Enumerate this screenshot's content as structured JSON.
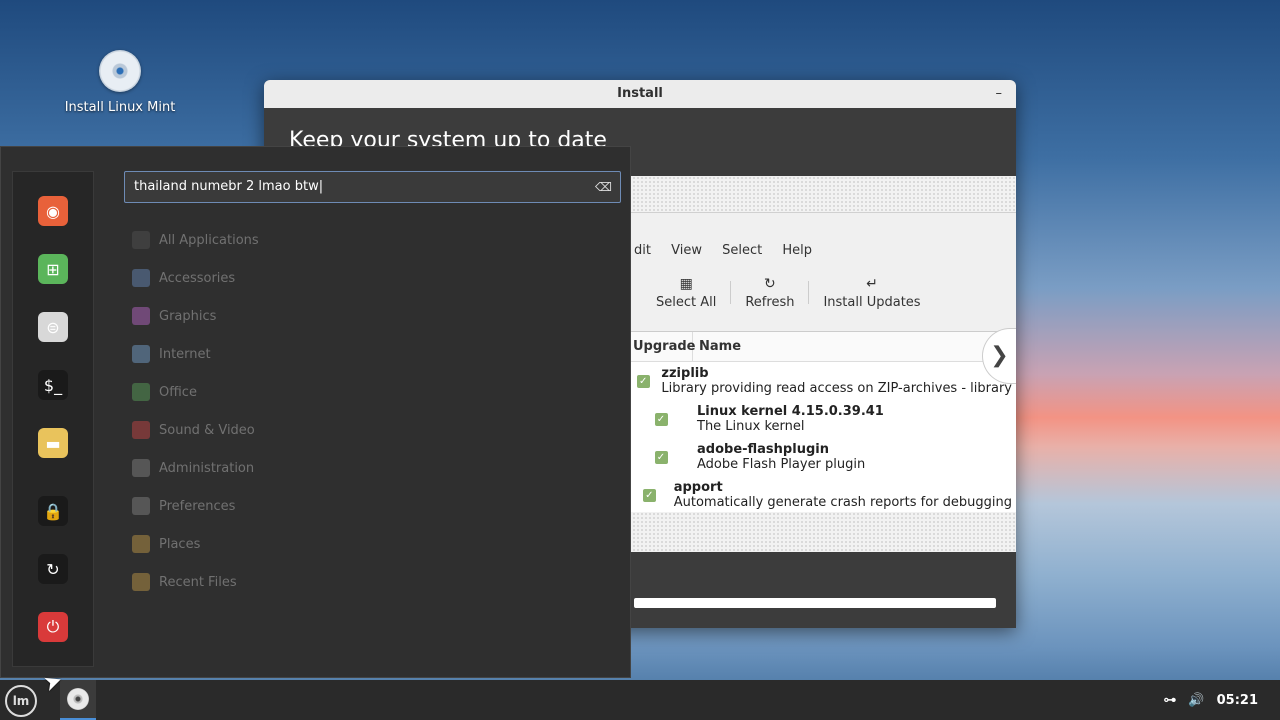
{
  "desktop": {
    "icon_label": "Install Linux Mint"
  },
  "window": {
    "title": "Install",
    "minimize": "–",
    "heading": "Keep your system up to date",
    "menu": [
      "dit",
      "View",
      "Select",
      "Help"
    ],
    "toolbar": [
      {
        "icon": "select-all-icon",
        "glyph": "▦",
        "label": "Select All"
      },
      {
        "icon": "refresh-icon",
        "glyph": "↻",
        "label": "Refresh"
      },
      {
        "icon": "install-icon",
        "glyph": "↵",
        "label": "Install Updates"
      }
    ],
    "columns": {
      "upgrade": "Upgrade",
      "name": "Name"
    },
    "rows": [
      {
        "name": "zziplib",
        "desc": "Library providing read access on ZIP-archives - library"
      },
      {
        "name": "Linux kernel 4.15.0.39.41",
        "desc": "The Linux kernel"
      },
      {
        "name": "adobe-flashplugin",
        "desc": "Adobe Flash Player plugin"
      },
      {
        "name": "apport",
        "desc": "Automatically generate crash reports for debugging"
      }
    ],
    "next_arrow": "❯"
  },
  "start_menu": {
    "search_value": "thailand numebr 2 lmao btw|",
    "categories": [
      {
        "label": "All Applications",
        "color": "#555555"
      },
      {
        "label": "Accessories",
        "color": "#6a8fc0"
      },
      {
        "label": "Graphics",
        "color": "#c06ad0"
      },
      {
        "label": "Internet",
        "color": "#7aa8d8"
      },
      {
        "label": "Office",
        "color": "#5ea85e"
      },
      {
        "label": "Sound & Video",
        "color": "#d04848"
      },
      {
        "label": "Administration",
        "color": "#888888"
      },
      {
        "label": "Preferences",
        "color": "#888888"
      },
      {
        "label": "Places",
        "color": "#c9a04a"
      },
      {
        "label": "Recent Files",
        "color": "#c9a04a"
      }
    ],
    "favorites": [
      {
        "name": "firefox-icon",
        "color": "#e8613a",
        "glyph": "◉"
      },
      {
        "name": "software-manager-icon",
        "color": "#5bb55b",
        "glyph": "⊞"
      },
      {
        "name": "settings-icon",
        "color": "#d8d8d8",
        "glyph": "⊜"
      },
      {
        "name": "terminal-icon",
        "color": "#1a1a1a",
        "glyph": "$_"
      },
      {
        "name": "folder-icon",
        "color": "#e9c35c",
        "glyph": "▬"
      },
      {
        "name": "lock-icon",
        "color": "#1a1a1a",
        "glyph": "🔒"
      },
      {
        "name": "logout-icon",
        "color": "#1a1a1a",
        "glyph": "↻"
      },
      {
        "name": "power-icon",
        "color": "#d93a3a",
        "glyph": "⏻"
      }
    ]
  },
  "taskbar": {
    "menu_label": "lm",
    "clock": "05:21",
    "network_glyph": "⊶",
    "volume_glyph": "🔊"
  }
}
